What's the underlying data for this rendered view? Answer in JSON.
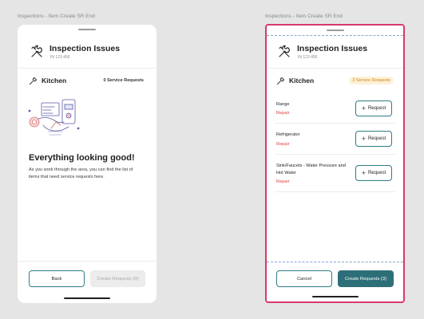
{
  "canvas": {
    "background": "#e5e5e5"
  },
  "frames": [
    {
      "frame_label": "Inspections - Item Create SR End",
      "header": {
        "title": "Inspection Issues",
        "subtitle": "IN 123 456",
        "icon": "wrench-screwdriver-icon"
      },
      "room": {
        "name": "Kitchen",
        "icon": "hammer-icon",
        "service_requests": "0 Service Requests"
      },
      "empty_state": {
        "title": "Everything looking good!",
        "body": "As you work through the area, you can find the list of items that need service requests here."
      },
      "footer": {
        "back_label": "Back",
        "create_label": "Create Requests (0)"
      }
    },
    {
      "frame_label": "Inspections - Item Create SR End",
      "header": {
        "title": "Inspection Issues",
        "subtitle": "IN 123 456",
        "icon": "wrench-screwdriver-icon"
      },
      "room": {
        "name": "Kitchen",
        "icon": "hammer-icon",
        "service_requests": "3 Service Requests"
      },
      "items": [
        {
          "name": "Range",
          "tag": "Repair",
          "button_label": "Request"
        },
        {
          "name": "Refrigerator",
          "tag": "Repair",
          "button_label": "Request"
        },
        {
          "name": "Sink/Faucets - Water Pressure and Hot Water",
          "tag": "Repair",
          "button_label": "Request"
        }
      ],
      "footer": {
        "cancel_label": "Cancel",
        "create_label": "Create Requests (3)"
      }
    }
  ],
  "colors": {
    "accent": "#2d6f79",
    "accent_border": "#2e7c83",
    "repair_tag": "#d63a3c",
    "selection_border": "#d63a6a",
    "badge_bg": "#fdf1d8",
    "badge_text": "#c98a1e"
  }
}
